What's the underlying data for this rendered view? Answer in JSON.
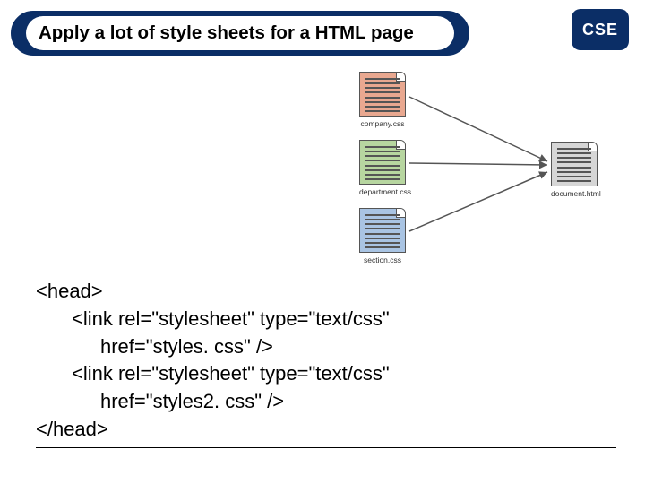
{
  "badge": "CSE",
  "title": "Apply a lot of style sheets for a HTML page",
  "diagram": {
    "files": {
      "company": "company.css",
      "department": "department.css",
      "section": "section.css",
      "document": "document.html"
    }
  },
  "code": {
    "line1": "<head>",
    "line2": "<link rel=\"stylesheet\" type=\"text/css\"",
    "line3": "href=\"styles. css\" />",
    "line4": "<link rel=\"stylesheet\" type=\"text/css\"",
    "line5": "href=\"styles2. css\" />",
    "line6": "</head>"
  }
}
